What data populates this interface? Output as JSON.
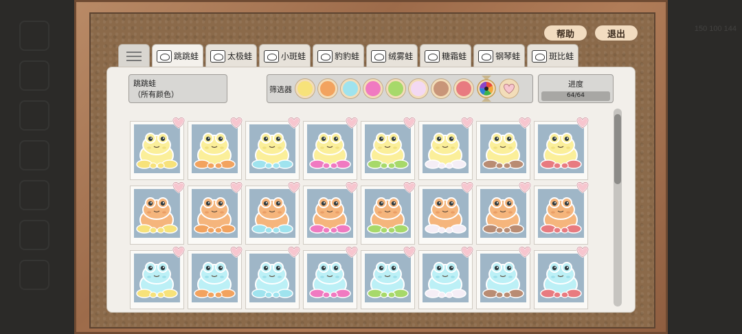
{
  "top_buttons": {
    "help": "帮助",
    "exit": "退出"
  },
  "background_number": "150 100 144",
  "tabs": [
    {
      "label": "跳跳蛙",
      "icon": "frog-icon"
    },
    {
      "label": "太极蛙",
      "icon": "frog-icon"
    },
    {
      "label": "小斑蛙",
      "icon": "frog-icon"
    },
    {
      "label": "豹豹蛙",
      "icon": "frog-icon"
    },
    {
      "label": "绒雾蛙",
      "icon": "frog-icon"
    },
    {
      "label": "糖霜蛙",
      "icon": "frog-icon"
    },
    {
      "label": "钢琴蛙",
      "icon": "frog-icon"
    },
    {
      "label": "斑比蛙",
      "icon": "frog-icon"
    }
  ],
  "info": {
    "name": "跳跳蛙",
    "subtitle": "（所有颜色）"
  },
  "filter": {
    "label": "筛选器",
    "swatches": [
      "#f7e27a",
      "#f2a35f",
      "#9fe3ee",
      "#f07ac1",
      "#a7d96a",
      "#f3d9f2",
      "#c89579",
      "#e87b80"
    ],
    "selected": "all-colors"
  },
  "progress": {
    "title": "进度",
    "text": "64/64",
    "fraction": 1.0
  },
  "grid": {
    "rows": [
      {
        "body": "#fbef9a",
        "shade": "#e9d56c"
      },
      {
        "body": "#f5b57c",
        "shade": "#e38d56"
      },
      {
        "body": "#bcf0f6",
        "shade": "#86d4e3"
      }
    ],
    "limbs": [
      "#f7e27a",
      "#f2a35f",
      "#9fe3ee",
      "#f07ac1",
      "#a7d96a",
      "#f5eef6",
      "#b98c73",
      "#e87b80"
    ]
  }
}
